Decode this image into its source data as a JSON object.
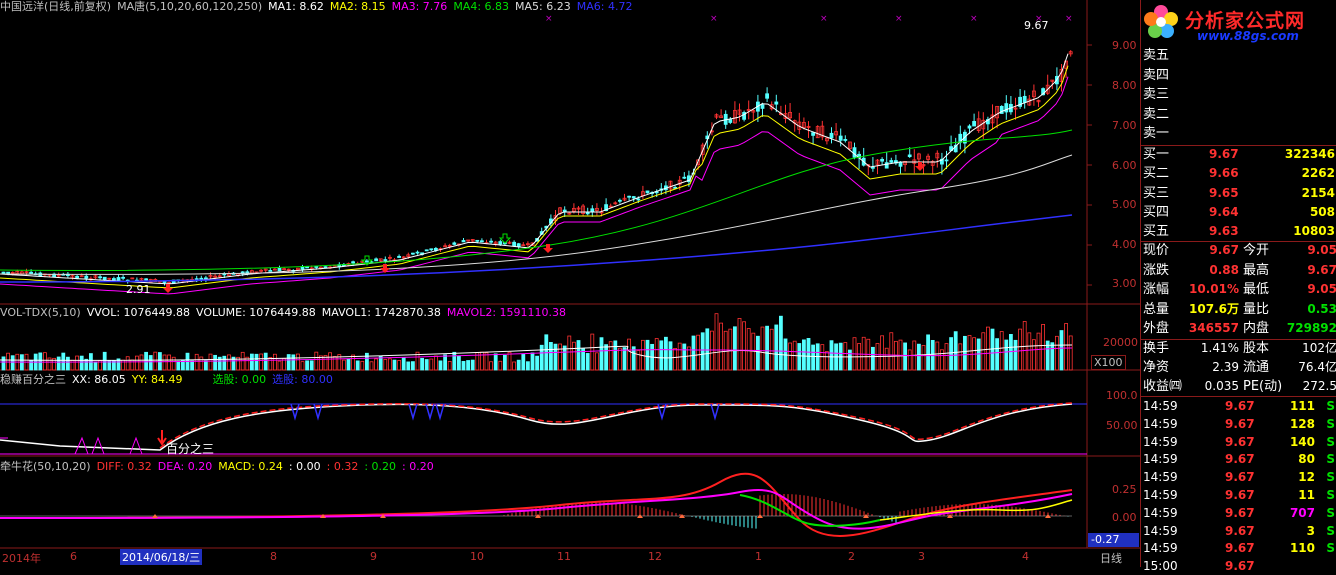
{
  "header": {
    "stock": "中国远洋(日线,前复权)",
    "ma_title": "MA唐(5,10,20,60,120,250)",
    "ma1": "MA1: 8.62",
    "ma2": "MA2: 8.15",
    "ma3": "MA3: 7.76",
    "ma4": "MA4: 6.83",
    "ma5": "MA5: 6.23",
    "ma6": "MA6: 4.72"
  },
  "price_axis": [
    "9.00",
    "8.00",
    "7.00",
    "6.00",
    "5.00",
    "4.00",
    "3.00"
  ],
  "high_label": "9.67",
  "low_label": "2.91",
  "vol_header": {
    "title": "VOL-TDX(5,10)",
    "vvol": "VVOL: 1076449.88",
    "volume": "VOLUME: 1076449.88",
    "mavol1": "MAVOL1: 1742870.38",
    "mavol2": "MAVOL2: 1591110.38"
  },
  "vol_axis": {
    "v": "20000",
    "unit": "X100"
  },
  "ind1_header": {
    "title": "稳赚百分之三",
    "xx": "XX: 86.05",
    "yy": "YY: 84.49",
    "pick": "选股: 0.00",
    "pick2": "选股: 80.00"
  },
  "ind1_axis": [
    "100.0",
    "50.00"
  ],
  "ind1_annot": "百分之三",
  "macd_header": {
    "title": "牵牛花(50,10,20)",
    "diff": "DIFF: 0.32",
    "dea": "DEA: 0.20",
    "macd": "MACD: 0.24",
    "v1": ": 0.00",
    "v2": ": 0.32",
    "v3": ": 0.20",
    "v4": ": 0.20"
  },
  "macd_axis": [
    "0.25",
    "0.00",
    "-0.27"
  ],
  "time_axis": {
    "year": "2014年",
    "cursor": "2014/06/18/三",
    "months": [
      "6",
      "8",
      "9",
      "10",
      "11",
      "12",
      "1",
      "2",
      "3",
      "4"
    ],
    "period": "日线"
  },
  "logo": {
    "title": "分析家公式网",
    "url": "www.88gs.com"
  },
  "sell_rows": [
    "卖五",
    "卖四",
    "卖三",
    "卖二",
    "卖一"
  ],
  "buy_rows": [
    {
      "label": "买一",
      "price": "9.67",
      "vol": "322346"
    },
    {
      "label": "买二",
      "price": "9.66",
      "vol": "2262"
    },
    {
      "label": "买三",
      "price": "9.65",
      "vol": "2154"
    },
    {
      "label": "买四",
      "price": "9.64",
      "vol": "508"
    },
    {
      "label": "买五",
      "price": "9.63",
      "vol": "10803"
    }
  ],
  "stats": [
    {
      "l1": "现价",
      "v1": "9.67",
      "l2": "今开",
      "v2": "9.05"
    },
    {
      "l1": "涨跌",
      "v1": "0.88",
      "l2": "最高",
      "v2": "9.67"
    },
    {
      "l1": "涨幅",
      "v1": "10.01%",
      "l2": "最低",
      "v2": "9.05"
    },
    {
      "l1": "总量",
      "v1": "107.6万",
      "l2": "量比",
      "v2": "0.53"
    },
    {
      "l1": "外盘",
      "v1": "346557",
      "l2": "内盘",
      "v2": "729892"
    }
  ],
  "stats2": [
    {
      "l1": "换手",
      "v1": "1.41%",
      "l2": "股本",
      "v2": "102亿"
    },
    {
      "l1": "净资",
      "v1": "2.39",
      "l2": "流通",
      "v2": "76.4亿"
    },
    {
      "l1": "收益㈣",
      "v1": "0.035",
      "l2": "PE(动)",
      "v2": "272.5"
    }
  ],
  "ticks": [
    {
      "t": "14:59",
      "p": "9.67",
      "v": "111",
      "s": "S"
    },
    {
      "t": "14:59",
      "p": "9.67",
      "v": "128",
      "s": "S"
    },
    {
      "t": "14:59",
      "p": "9.67",
      "v": "140",
      "s": "S"
    },
    {
      "t": "14:59",
      "p": "9.67",
      "v": "80",
      "s": "S"
    },
    {
      "t": "14:59",
      "p": "9.67",
      "v": "12",
      "s": "S"
    },
    {
      "t": "14:59",
      "p": "9.67",
      "v": "11",
      "s": "S"
    },
    {
      "t": "14:59",
      "p": "9.67",
      "v": "707",
      "s": "S"
    },
    {
      "t": "14:59",
      "p": "9.67",
      "v": "3",
      "s": "S"
    },
    {
      "t": "14:59",
      "p": "9.67",
      "v": "110",
      "s": "S"
    },
    {
      "t": "15:00",
      "p": "9.67",
      "v": "",
      "s": ""
    }
  ],
  "colors": {
    "up": "#ff3232",
    "down": "#54ffff",
    "ma1": "#ffffff",
    "ma2": "#ffff00",
    "ma3": "#ff00ff",
    "ma4": "#00e000",
    "ma5": "#dcdcdc",
    "ma6": "#3030ff",
    "frame": "#8a1a1a"
  }
}
